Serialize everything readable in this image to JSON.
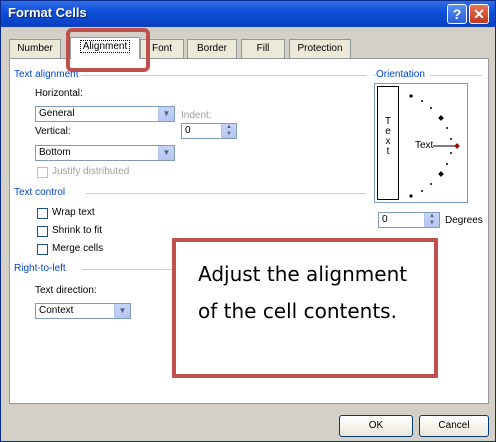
{
  "window": {
    "title": "Format Cells"
  },
  "titlebar": {
    "help_label": "?",
    "close_label": "✕"
  },
  "tabs": [
    {
      "label": "Number"
    },
    {
      "label": "Alignment"
    },
    {
      "label": "Font"
    },
    {
      "label": "Border"
    },
    {
      "label": "Fill"
    },
    {
      "label": "Protection"
    }
  ],
  "text_alignment": {
    "group_title": "Text alignment",
    "horizontal_label": "Horizontal:",
    "horizontal_value": "General",
    "indent_label": "Indent:",
    "indent_value": "0",
    "vertical_label": "Vertical:",
    "vertical_value": "Bottom",
    "justify_label": "Justify distributed"
  },
  "text_control": {
    "group_title": "Text control",
    "wrap_label": "Wrap text",
    "shrink_label": "Shrink to fit",
    "merge_label": "Merge cells"
  },
  "rtl": {
    "group_title": "Right-to-left",
    "direction_label": "Text direction:",
    "direction_value": "Context"
  },
  "orientation": {
    "group_title": "Orientation",
    "vertical_text": "T e x t",
    "dial_text": "Text",
    "degrees_value": "0",
    "degrees_label": "Degrees"
  },
  "buttons": {
    "ok": "OK",
    "cancel": "Cancel"
  },
  "callout": {
    "text": "Adjust the alignment of the cell contents."
  },
  "colors": {
    "accent": "#c0504d",
    "group_title": "#0046d5",
    "titlebar": "#0d4ed8"
  }
}
